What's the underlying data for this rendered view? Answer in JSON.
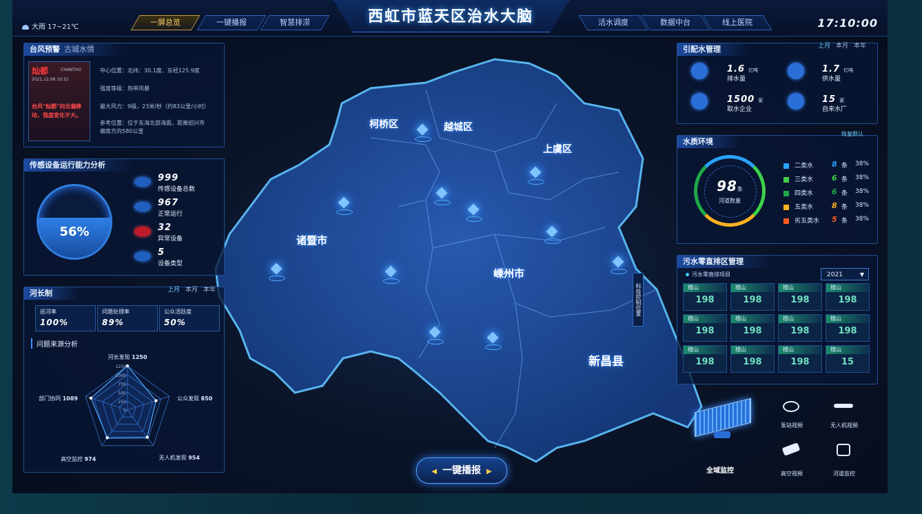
{
  "header": {
    "weather": "大雨  17~21℃",
    "title": "西虹市蓝天区治水大脑",
    "clock": "17:10:00",
    "nav_left": [
      "一屏总览",
      "一键播报",
      "智慧排涝"
    ],
    "nav_right": [
      "活水调度",
      "数据中台",
      "线上医院"
    ]
  },
  "typhoon": {
    "title": "台风预警",
    "subtitle": "古城水情",
    "name": "灿都",
    "name_en": "CHANTHU",
    "datetime": "2021.12.08  10:32",
    "alert": "台风\"灿都\"向北偏移动，强度变化不大。",
    "center": "中心位置：北纬：30.1度、东经125.9度",
    "level": "强度等级：热带风暴",
    "wind": "最大风力：9级，23米/秒（约83公里/小时）",
    "reference_1": "参考位置：位于东海北部海面，距离绍兴市",
    "reference_2": "偏南方向580公里"
  },
  "sensor": {
    "title": "传感设备运行能力分析",
    "percent": "56%",
    "items": [
      {
        "value": "999",
        "label": "传感设备总数",
        "icon": "device-total-icon"
      },
      {
        "value": "967",
        "label": "正常运行",
        "icon": "gear-icon"
      },
      {
        "value": "32",
        "label": "异常设备",
        "icon": "alarm-icon"
      },
      {
        "value": "5",
        "label": "设备类型",
        "icon": "stack-icon"
      }
    ]
  },
  "river": {
    "title": "河长制",
    "periods": [
      "上月",
      "本月",
      "本年"
    ],
    "kpis": [
      {
        "label": "巡河率",
        "value": "100%"
      },
      {
        "label": "问题处理率",
        "value": "89%"
      },
      {
        "label": "公众活跃度",
        "value": "50%"
      }
    ],
    "source_title": "问题来源分析",
    "radar_ticks": [
      "1250",
      "1000",
      "750",
      "500",
      "250",
      "0"
    ],
    "radar": [
      {
        "label": "河长发现",
        "value": 1250
      },
      {
        "label": "公众发现",
        "value": 850
      },
      {
        "label": "无人机发现",
        "value": 954
      },
      {
        "label": "高空监控",
        "value": 974
      },
      {
        "label": "部门协同",
        "value": 1089
      }
    ]
  },
  "map": {
    "districts": [
      "柯桥区",
      "越城区",
      "上虞区",
      "诸暨市",
      "嵊州市",
      "新昌县"
    ],
    "vertical_label": "科技控制位置",
    "action": "一键播报"
  },
  "water_supply": {
    "title": "引配水管理",
    "periods": [
      "上月",
      "本月",
      "本年"
    ],
    "items": [
      {
        "value": "1.6",
        "unit": "亿吨",
        "label": "排水量",
        "icon": "drain-icon"
      },
      {
        "value": "1.7",
        "unit": "亿吨",
        "label": "供水量",
        "icon": "water-drop-icon"
      },
      {
        "value": "1500",
        "unit": "家",
        "label": "取水企业",
        "icon": "clock-icon"
      },
      {
        "value": "15",
        "unit": "家",
        "label": "自来水厂",
        "icon": "factory-icon"
      }
    ]
  },
  "water_quality": {
    "title": "水质环境",
    "reset": "恢复默认",
    "total": "98",
    "total_unit": "条",
    "total_label": "河道数量",
    "rows": [
      {
        "name": "二类水",
        "count": "8",
        "unit": "条",
        "pct": "38%",
        "color": "#2aa3ff"
      },
      {
        "name": "三类水",
        "count": "6",
        "unit": "条",
        "pct": "38%",
        "color": "#3fd14a"
      },
      {
        "name": "四类水",
        "count": "6",
        "unit": "条",
        "pct": "38%",
        "color": "#1fa84a"
      },
      {
        "name": "五类水",
        "count": "8",
        "unit": "条",
        "pct": "38%",
        "color": "#ffb21f"
      },
      {
        "name": "劣五类水",
        "count": "5",
        "unit": "条",
        "pct": "38%",
        "color": "#ff5a1f"
      }
    ]
  },
  "sewage": {
    "title": "污水零直排区管理",
    "legend": "污水零直排项目",
    "year": "2021",
    "rows": [
      [
        {
          "name": "稽山",
          "value": "198"
        },
        {
          "name": "稽山",
          "value": "198"
        },
        {
          "name": "稽山",
          "value": "198"
        },
        {
          "name": "稽山",
          "value": "198"
        }
      ],
      [
        {
          "name": "稽山",
          "value": "198"
        },
        {
          "name": "稽山",
          "value": "198"
        },
        {
          "name": "稽山",
          "value": "198"
        },
        {
          "name": "稽山",
          "value": "198"
        }
      ],
      [
        {
          "name": "稽山",
          "value": "198"
        },
        {
          "name": "稽山",
          "value": "198"
        },
        {
          "name": "稽山",
          "value": "198"
        },
        {
          "name": "稽山",
          "value": "15"
        }
      ]
    ]
  },
  "monitoring": {
    "main_label": "全域监控",
    "items": [
      {
        "label": "泵站视频",
        "icon": "pump-camera-icon"
      },
      {
        "label": "无人机视频",
        "icon": "drone-icon"
      },
      {
        "label": "高空视频",
        "icon": "high-camera-icon"
      },
      {
        "label": "河道监控",
        "icon": "river-camera-icon"
      }
    ]
  }
}
